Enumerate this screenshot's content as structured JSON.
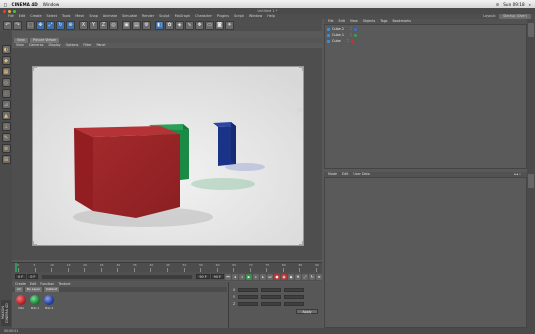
{
  "menubar": {
    "app_name": "CINEMA 4D",
    "items": [
      "Window"
    ],
    "clock": "Sun 09:18",
    "search_icon": "search-icon"
  },
  "window": {
    "title": "Untitled 1 *"
  },
  "app_menu": {
    "items": [
      "File",
      "Edit",
      "Create",
      "Select",
      "Tools",
      "Mesh",
      "Snap",
      "Animate",
      "Simulate",
      "Render",
      "Sculpt",
      "MoGraph",
      "Character",
      "Plugins",
      "Script",
      "Window",
      "Help"
    ],
    "layout_label": "Layout:",
    "layout_value": "Startup (User)"
  },
  "viewport": {
    "tabs": [
      "View",
      "Picture Viewer"
    ],
    "menu": [
      "View",
      "Cameras",
      "Display",
      "Options",
      "Filter",
      "Panel"
    ]
  },
  "timeline": {
    "ticks": [
      "0",
      "5",
      "10",
      "15",
      "20",
      "25",
      "30",
      "35",
      "40",
      "45",
      "50",
      "55",
      "60",
      "65",
      "70",
      "75",
      "80",
      "85",
      "90"
    ],
    "start_field": "0 F",
    "current_field": "0 F",
    "end_field": "90 F",
    "end_field2": "90 F"
  },
  "material_manager": {
    "menu": [
      "Create",
      "Edit",
      "Function",
      "Texture"
    ],
    "filters": [
      "All",
      "No Layer",
      "Default"
    ],
    "materials": [
      {
        "name": "Mat",
        "color": "#c0272d"
      },
      {
        "name": "Mat.1",
        "color": "#1f8a3c"
      },
      {
        "name": "Mat.2",
        "color": "#2a48a6"
      }
    ]
  },
  "coordinates": {
    "rows": [
      {
        "axis": "X",
        "pos": "0 cm",
        "size": "0 cm",
        "rot": "0°"
      },
      {
        "axis": "Y",
        "pos": "0 cm",
        "size": "0 cm",
        "rot": "0°"
      },
      {
        "axis": "Z",
        "pos": "0 cm",
        "size": "0 cm",
        "rot": "0°"
      }
    ],
    "apply_label": "Apply"
  },
  "object_manager": {
    "menu": [
      "File",
      "Edit",
      "View",
      "Objects",
      "Tags",
      "Bookmarks"
    ],
    "objects": [
      {
        "name": "Cube.2",
        "tag_color": "#3a6fd8"
      },
      {
        "name": "Cube.1",
        "tag_color": "#2fa84a"
      },
      {
        "name": "Cube",
        "tag_color": "#c7342f"
      }
    ]
  },
  "attribute_manager": {
    "menu": [
      "Mode",
      "Edit",
      "User Data"
    ]
  },
  "status": {
    "text": "00:00:01"
  },
  "side_label": "MAXON CINEMA 4D",
  "colors": {
    "red_cube": "#a82a2c",
    "green_cube": "#1a8a45",
    "blue_cube": "#1e3a8c",
    "accent_blue": "#3d6fa8"
  }
}
